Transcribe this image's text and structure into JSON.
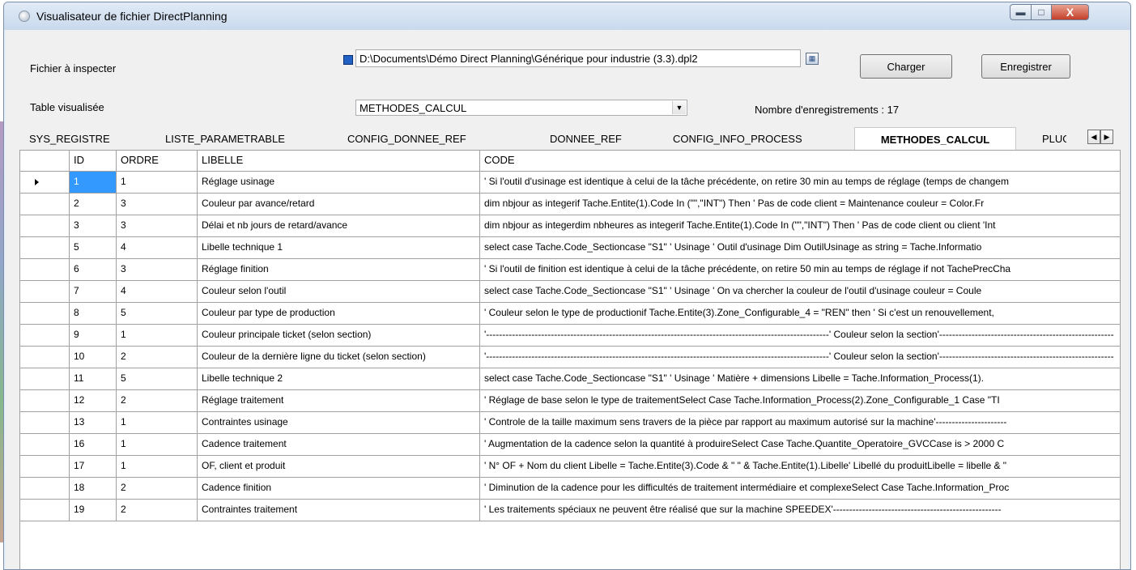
{
  "window": {
    "title": "Visualisateur de fichier DirectPlanning",
    "close_glyph": "X"
  },
  "form": {
    "file_label": "Fichier à inspecter",
    "file_path": "D:\\Documents\\Démo Direct Planning\\Générique pour  industrie (3.3).dpl2",
    "load_button": "Charger",
    "save_button": "Enregistrer",
    "table_label": "Table visualisée",
    "table_selected": "METHODES_CALCUL",
    "record_count": "Nombre d'enregistrements : 17"
  },
  "tabs": [
    {
      "label": "SYS_REGISTRE"
    },
    {
      "label": "LISTE_PARAMETRABLE"
    },
    {
      "label": "CONFIG_DONNEE_REF"
    },
    {
      "label": "DONNEE_REF"
    },
    {
      "label": "CONFIG_INFO_PROCESS"
    },
    {
      "label": "METHODES_CALCUL",
      "active": true
    },
    {
      "label": "PLUG"
    }
  ],
  "grid": {
    "columns": [
      "ID",
      "ORDRE",
      "LIBELLE",
      "CODE"
    ],
    "rows": [
      [
        "1",
        "1",
        "Réglage usinage",
        "' Si l'outil d'usinage est identique à celui de la tâche précédente, on retire 30 min au temps de réglage  (temps de changem"
      ],
      [
        "2",
        "3",
        "Couleur par avance/retard",
        "dim nbjour as integerif Tache.Entite(1).Code In (\"\",\"INT\") Then   ' Pas de code client = Maintenance    couleur = Color.Fr"
      ],
      [
        "3",
        "3",
        "Délai et nb jours de retard/avance",
        "dim nbjour as integerdim nbheures as integerif Tache.Entite(1).Code In (\"\",\"INT\") Then   ' Pas de code client ou client 'Int"
      ],
      [
        "5",
        "4",
        "Libelle technique 1",
        "select case Tache.Code_Sectioncase \"S1\"  ' Usinage    ' Outil d'usinage    Dim OutilUsinage as string = Tache.Informatio"
      ],
      [
        "6",
        "3",
        "Réglage finition",
        "' Si l'outil de finition est identique à celui de la tâche précédente, on retire 50 min au temps de réglage if not TachePrecCha"
      ],
      [
        "7",
        "4",
        "Couleur selon l'outil",
        "select case Tache.Code_Sectioncase \"S1\"  ' Usinage    ' On va chercher la couleur de l'outil d'usinage    couleur = Coule"
      ],
      [
        "8",
        "5",
        "Couleur par type de production",
        "' Couleur selon le type de productionif Tache.Entite(3).Zone_Configurable_4 = \"REN\" then   ' Si c'est un renouvellement,"
      ],
      [
        "9",
        "1",
        "Couleur principale ticket (selon section)",
        "'----------------------------------------------------------------------------------------------------------' Couleur selon la section'------------------------------------------------------"
      ],
      [
        "10",
        "2",
        "Couleur de la dernière ligne du ticket (selon section)",
        "'----------------------------------------------------------------------------------------------------------' Couleur selon la section'------------------------------------------------------"
      ],
      [
        "11",
        "5",
        "Libelle technique 2",
        "select case Tache.Code_Sectioncase \"S1\"  ' Usinage    ' Matière + dimensions    Libelle = Tache.Information_Process(1)."
      ],
      [
        "12",
        "2",
        "Réglage traitement",
        "' Réglage de base selon le type de traitementSelect Case Tache.Information_Process(2).Zone_Configurable_1   Case \"TI"
      ],
      [
        "13",
        "1",
        "Contraintes usinage",
        "' Controle de la taille maximum sens travers de la pièce par rapport au maximum autorisé sur la machine'----------------------"
      ],
      [
        "16",
        "1",
        "Cadence traitement",
        "' Augmentation de la cadence selon la quantité à produireSelect Case Tache.Quantite_Operatoire_GVCCase is > 2000   C"
      ],
      [
        "17",
        "1",
        "OF, client et produit",
        "' N° OF + Nom du client Libelle = Tache.Entite(3).Code & \" \" & Tache.Entite(1).Libelle' Libellé du produitLibelle = libelle & \""
      ],
      [
        "18",
        "2",
        "Cadence finition",
        "' Diminution de la cadence pour les difficultés de traitement intermédiaire et complexeSelect Case Tache.Information_Proc"
      ],
      [
        "19",
        "2",
        "Contraintes traitement",
        "' Les traitements spéciaux ne peuvent être réalisé que sur la machine SPEEDEX'----------------------------------------------------"
      ]
    ]
  },
  "colors": {
    "selection": "#3399ff",
    "window_frame": "#e6eef7",
    "close_button": "#c4402a"
  },
  "icons": [
    "app-icon",
    "minimize-icon",
    "maximize-icon",
    "close-icon",
    "file-type-icon",
    "browse-icon",
    "dropdown-arrow-icon",
    "tab-scroll-left-icon",
    "tab-scroll-right-icon",
    "row-selector-icon"
  ]
}
